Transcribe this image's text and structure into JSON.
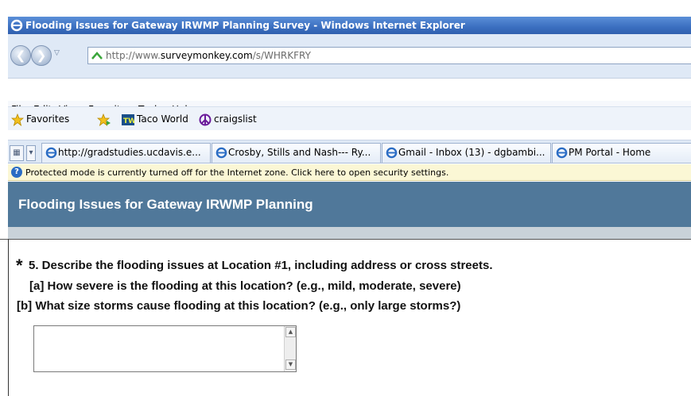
{
  "window": {
    "title": "Flooding Issues for Gateway IRWMP Planning Survey - Windows Internet Explorer"
  },
  "address": {
    "url_prefix": "http://www.",
    "url_domain": "surveymonkey.com",
    "url_path": "/s/WHRKFRY"
  },
  "menu": [
    "File",
    "Edit",
    "View",
    "Favorites",
    "Tools",
    "Help"
  ],
  "favorites_bar": {
    "favorites_label": "Favorites",
    "links": [
      "Taco World",
      "craigslist"
    ]
  },
  "tabs": [
    "http://gradstudies.ucdavis.e...",
    "Crosby, Stills and Nash--- Ry...",
    "Gmail - Inbox (13) - dgbambi...",
    "PM Portal - Home"
  ],
  "infobar": {
    "text": "Protected mode is currently turned off for the Internet zone.  Click here to open security settings."
  },
  "survey": {
    "header": "Flooding Issues for Gateway IRWMP Planning",
    "question": {
      "required_marker": "*",
      "line1": "5. Describe the flooding issues at Location #1, including address or cross streets.",
      "line2": "[a] How severe is the flooding at this location? (e.g., mild, moderate, severe)",
      "line3": "[b] What size storms cause flooding at this location? (e.g., only large storms?)",
      "answer_value": ""
    }
  },
  "colors": {
    "header_bg": "#50789a",
    "titlebar": "#3b6fc0",
    "infobar_bg": "#fbf7d5"
  }
}
